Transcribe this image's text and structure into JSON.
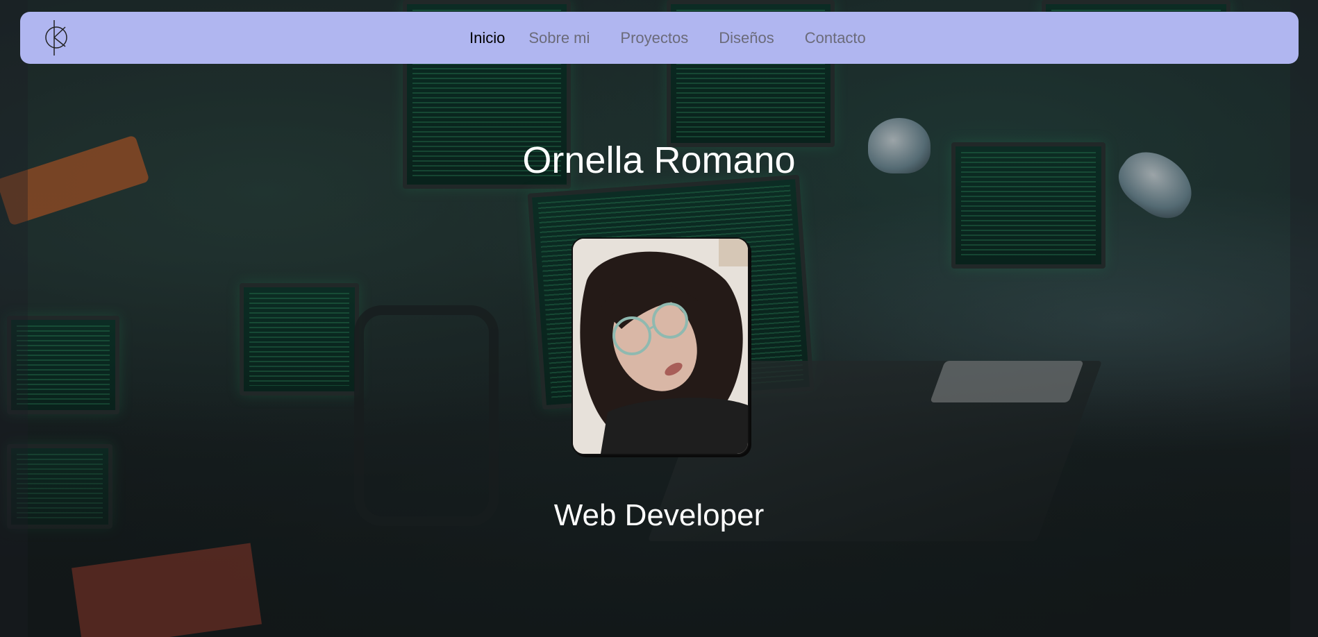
{
  "navbar": {
    "logo_icon": "ko-monogram-logo",
    "background_color": "#b0b6f0",
    "links": [
      {
        "label": "Inicio",
        "active": true
      },
      {
        "label": "Sobre mi",
        "active": false
      },
      {
        "label": "Proyectos",
        "active": false
      },
      {
        "label": "Diseños",
        "active": false
      },
      {
        "label": "Contacto",
        "active": false
      }
    ]
  },
  "hero": {
    "name": "Ornella Romano",
    "role": "Web Developer",
    "avatar_alt": "profile-photo"
  }
}
